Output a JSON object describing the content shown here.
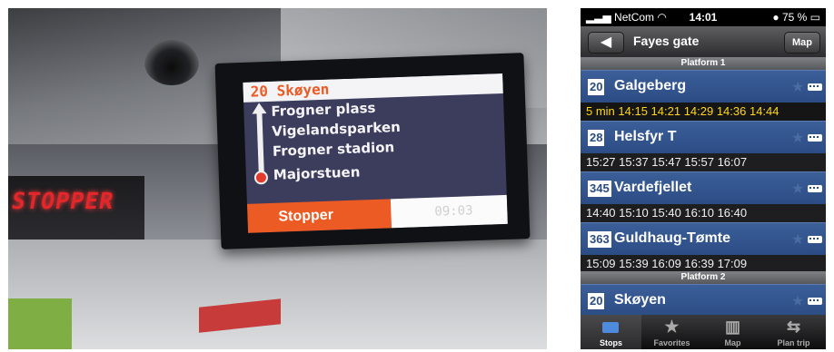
{
  "photo": {
    "stopper_sign": "STOPPER",
    "display": {
      "route_header": "20 Skøyen",
      "stops": [
        "Frogner plass",
        "Vigelandsparken",
        "Frogner stadion",
        "Majorstuen"
      ],
      "footer_status": "Stopper",
      "footer_time": "09:03"
    }
  },
  "phone": {
    "status_bar": {
      "carrier": "NetCom",
      "time": "14:01",
      "battery": "75 %"
    },
    "nav": {
      "back_icon": "back-arrow-icon",
      "title": "Fayes gate",
      "map_button": "Map"
    },
    "platforms": [
      {
        "label": "Platform 1"
      },
      {
        "label": "Platform 2"
      }
    ],
    "routes": [
      {
        "number": "20",
        "name": "Galgeberg",
        "times": "5 min  14:15  14:21  14:29  14:36  14:44"
      },
      {
        "number": "28",
        "name": "Helsfyr T",
        "times": "15:27  15:37  15:47  15:57  16:07"
      },
      {
        "number": "345",
        "name": "Vardefjellet",
        "times": "14:40  15:10  15:40  16:10  16:40"
      },
      {
        "number": "363",
        "name": "Guldhaug-Tømte",
        "times": "15:09  15:39  16:09  16:39  17:09"
      },
      {
        "number": "20",
        "name": "Skøyen",
        "times": ""
      }
    ],
    "tabs": [
      {
        "label": "Stops",
        "icon": "bus-icon",
        "active": true
      },
      {
        "label": "Favorites",
        "icon": "star-icon",
        "active": false
      },
      {
        "label": "Map",
        "icon": "map-icon",
        "active": false
      },
      {
        "label": "Plan trip",
        "icon": "route-icon",
        "active": false
      }
    ],
    "colors": {
      "accent_yellow": "#ffd81a",
      "route_blue": "#2b4b83"
    }
  }
}
